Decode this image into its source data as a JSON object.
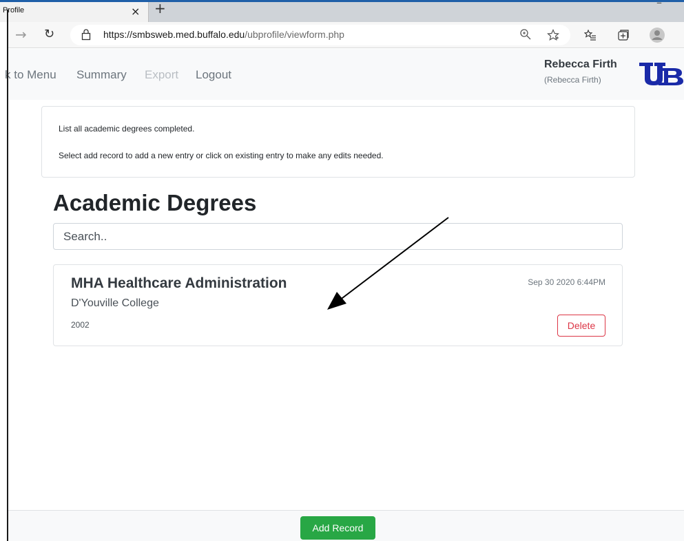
{
  "browser": {
    "tab_title": "Profile",
    "tab_close": "×",
    "new_tab": "+",
    "minimize": "–",
    "forward": "→",
    "refresh": "↻",
    "url_host": "https://smbsweb.med.buffalo.edu",
    "url_path": "/ubprofile/viewform.php",
    "icons": [
      "zoom-icon",
      "favorite-star-icon",
      "favorites-list-icon",
      "collections-icon",
      "profile-icon"
    ]
  },
  "nav": {
    "back_to_menu": "k to Menu",
    "summary": "Summary",
    "export": "Export",
    "logout": "Logout",
    "user_name": "Rebecca Firth",
    "user_sub": "(Rebecca Firth)"
  },
  "info": {
    "line1": "List all academic degrees completed.",
    "line2": "Select add record to add a new entry or click on existing entry to make any edits needed."
  },
  "page": {
    "title": "Academic Degrees",
    "search_placeholder": "Search.."
  },
  "records": [
    {
      "degree": "MHA Healthcare Administration",
      "school": "D'Youville College",
      "year": "2002",
      "timestamp": "Sep 30 2020 6:44PM",
      "delete_label": "Delete"
    }
  ],
  "footer": {
    "add_label": "Add Record"
  },
  "colors": {
    "success": "#28a745",
    "danger": "#dc3545",
    "ub_blue": "#1a2aa8"
  }
}
